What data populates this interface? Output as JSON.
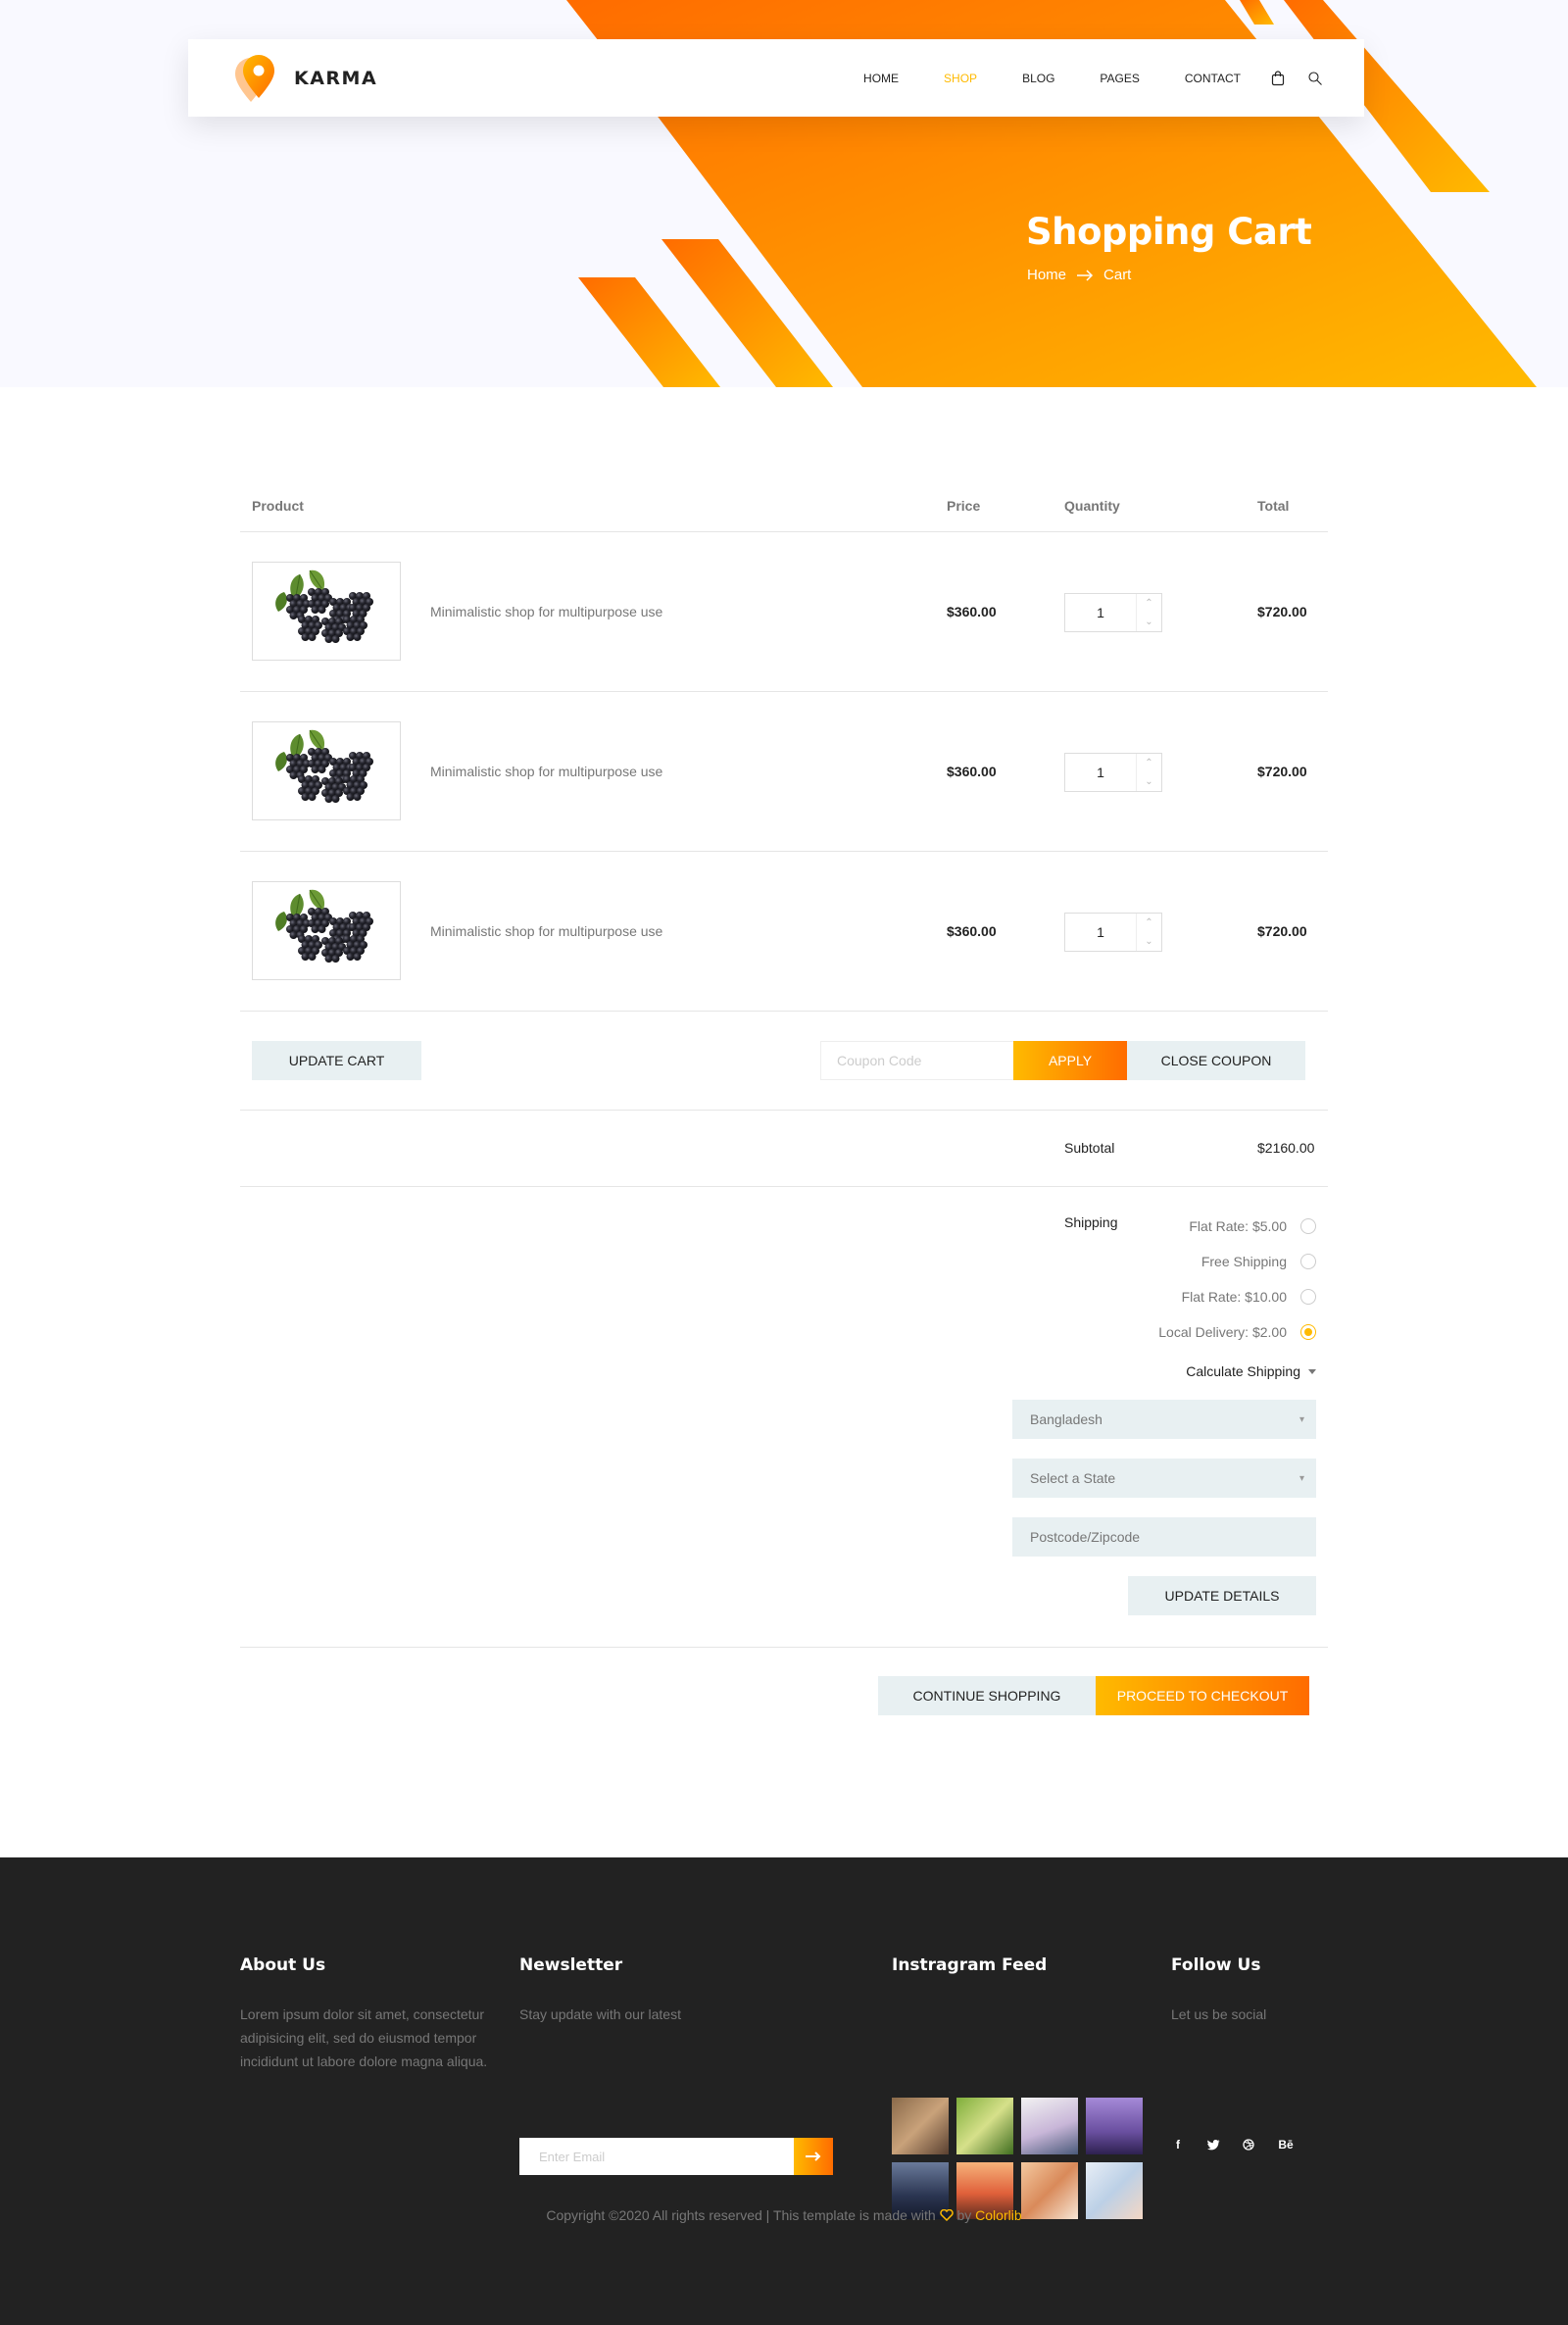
{
  "brand": {
    "name": "KARMA"
  },
  "nav": {
    "items": [
      {
        "label": "HOME",
        "active": false
      },
      {
        "label": "SHOP",
        "active": true
      },
      {
        "label": "BLOG",
        "active": false
      },
      {
        "label": "PAGES",
        "active": false
      },
      {
        "label": "CONTACT",
        "active": false
      }
    ],
    "icons": [
      "shopping-bag-icon",
      "search-icon"
    ]
  },
  "banner": {
    "title": "Shopping Cart",
    "breadcrumb": [
      "Home",
      "Cart"
    ]
  },
  "cart": {
    "headers": {
      "product": "Product",
      "price": "Price",
      "quantity": "Quantity",
      "total": "Total"
    },
    "items": [
      {
        "name": "Minimalistic shop for multipurpose use",
        "price": "$360.00",
        "quantity": "1",
        "total": "$720.00"
      },
      {
        "name": "Minimalistic shop for multipurpose use",
        "price": "$360.00",
        "quantity": "1",
        "total": "$720.00"
      },
      {
        "name": "Minimalistic shop for multipurpose use",
        "price": "$360.00",
        "quantity": "1",
        "total": "$720.00"
      }
    ],
    "update_cart_label": "UPDATE CART",
    "coupon_placeholder": "Coupon Code",
    "apply_label": "APPLY",
    "close_coupon_label": "CLOSE COUPON",
    "subtotal_label": "Subtotal",
    "subtotal_value": "$2160.00",
    "shipping_label": "Shipping",
    "shipping_options": [
      {
        "label": "Flat Rate: $5.00",
        "checked": false
      },
      {
        "label": "Free Shipping",
        "checked": false
      },
      {
        "label": "Flat Rate: $10.00",
        "checked": false
      },
      {
        "label": "Local Delivery: $2.00",
        "checked": true
      }
    ],
    "calculate_shipping_label": "Calculate Shipping",
    "country_value": "Bangladesh",
    "state_placeholder": "Select a State",
    "postcode_placeholder": "Postcode/Zipcode",
    "update_details_label": "UPDATE DETAILS",
    "continue_shopping_label": "CONTINUE SHOPPING",
    "checkout_label": "PROCEED TO CHECKOUT"
  },
  "footer": {
    "about": {
      "title": "About Us",
      "text": "Lorem ipsum dolor sit amet, consectetur adipisicing elit, sed do eiusmod tempor incididunt ut labore dolore magna aliqua."
    },
    "newsletter": {
      "title": "Newsletter",
      "text": "Stay update with our latest",
      "placeholder": "Enter Email"
    },
    "instagram": {
      "title": "Instragram Feed"
    },
    "follow": {
      "title": "Follow Us",
      "text": "Let us be social",
      "icons": [
        "facebook-icon",
        "twitter-icon",
        "dribbble-icon",
        "behance-icon"
      ]
    },
    "copyright_text": "Copyright ©2020 All rights reserved | This template is made with",
    "copyright_by": "by",
    "copyright_brand": "Colorlib"
  },
  "colors": {
    "accent": "#ffba00",
    "accent_dark": "#ff6c00",
    "footer_bg": "#222222",
    "banner_bg": "#f9f9ff"
  }
}
